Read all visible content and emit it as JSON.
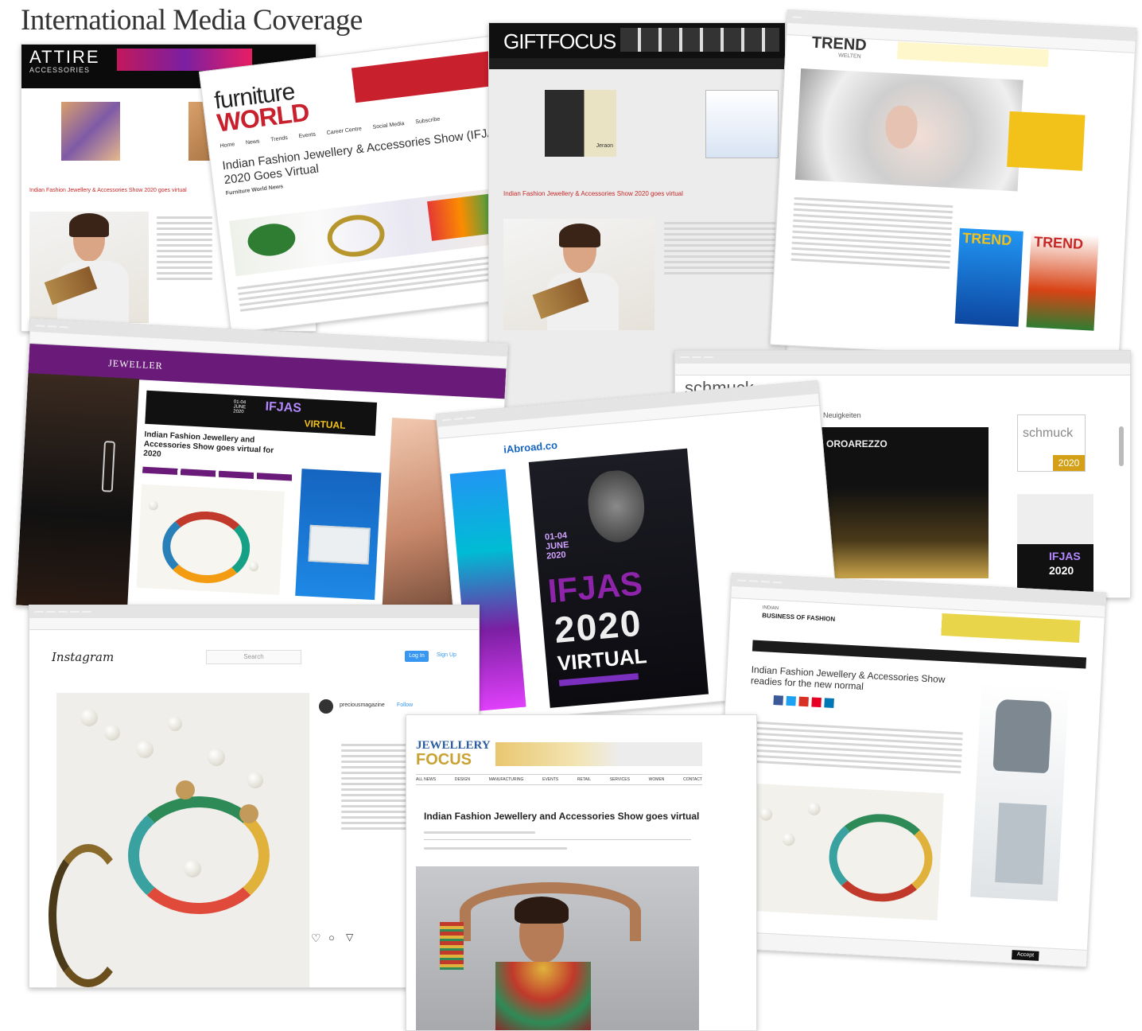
{
  "title": "International Media Coverage",
  "screens": {
    "attire": {
      "logo_line1": "ATTIRE",
      "logo_line2": "ACCESSORIES",
      "headline": "Indian Fashion Jewellery & Accessories Show 2020 goes virtual"
    },
    "furniture": {
      "logo_line1": "furniture",
      "logo_line2": "WORLD",
      "nav": [
        "Home",
        "News",
        "Trends",
        "Events",
        "Career Centre",
        "Social Media",
        "Subscribe"
      ],
      "headline": "Indian Fashion Jewellery & Accessories Show (IFJAS), 2020 Goes Virtual",
      "sub": "Furniture World News"
    },
    "giftfocus": {
      "logo": "GIFTFOCUS",
      "headline": "Indian Fashion Jewellery & Accessories Show 2020 goes virtual",
      "ad": "Jeraon"
    },
    "trend": {
      "logo": "TREND",
      "logo_sub": "WELTEN",
      "cover1": "TREND",
      "cover2": "TREND"
    },
    "jeweller": {
      "logo": "JEWELLER",
      "banner_date": "01-04 JUNE 2020",
      "banner_name": "IFJAS",
      "banner_virtual": "VIRTUAL",
      "headline": "Indian Fashion Jewellery and Accessories Show goes virtual for 2020"
    },
    "schmuck": {
      "logo": "schmuck",
      "label": "Neuigkeiten",
      "venue": "OROAREZZO",
      "side_logo": "schmuck",
      "year": "2020",
      "banner_name": "IFJAS",
      "banner_year": "2020"
    },
    "iabroad": {
      "logo": "iAbroad.co",
      "date": "01-04 JUNE 2020",
      "name": "IFJAS",
      "year": "2020",
      "virtual": "VIRTUAL"
    },
    "instagram": {
      "logo": "Instagram",
      "search": "Search",
      "login": "Log In",
      "signup": "Sign Up",
      "account": "preciousmagazine",
      "follow": "Follow"
    },
    "jewelleryfocus": {
      "logo_line1": "JEWELLERY",
      "logo_line2": "FOCUS",
      "nav": [
        "ALL NEWS",
        "DESIGN",
        "MANUFACTURING",
        "EVENTS",
        "RETAIL",
        "SERVICES",
        "WOMEN",
        "CONTACT"
      ],
      "headline": "Indian Fashion Jewellery and Accessories Show goes virtual"
    },
    "bof": {
      "logo_line1": "INDIAN",
      "logo_line2": "BUSINESS OF FASHION",
      "headline": "Indian Fashion Jewellery & Accessories Show readies for the new normal",
      "accept": "Accept"
    }
  },
  "colors": {
    "purple": "#6a1b7a",
    "ifjas_violet": "#7b2fbe",
    "gold": "#f2c21b",
    "red_bar": "#c8202c",
    "dark": "#111111"
  }
}
